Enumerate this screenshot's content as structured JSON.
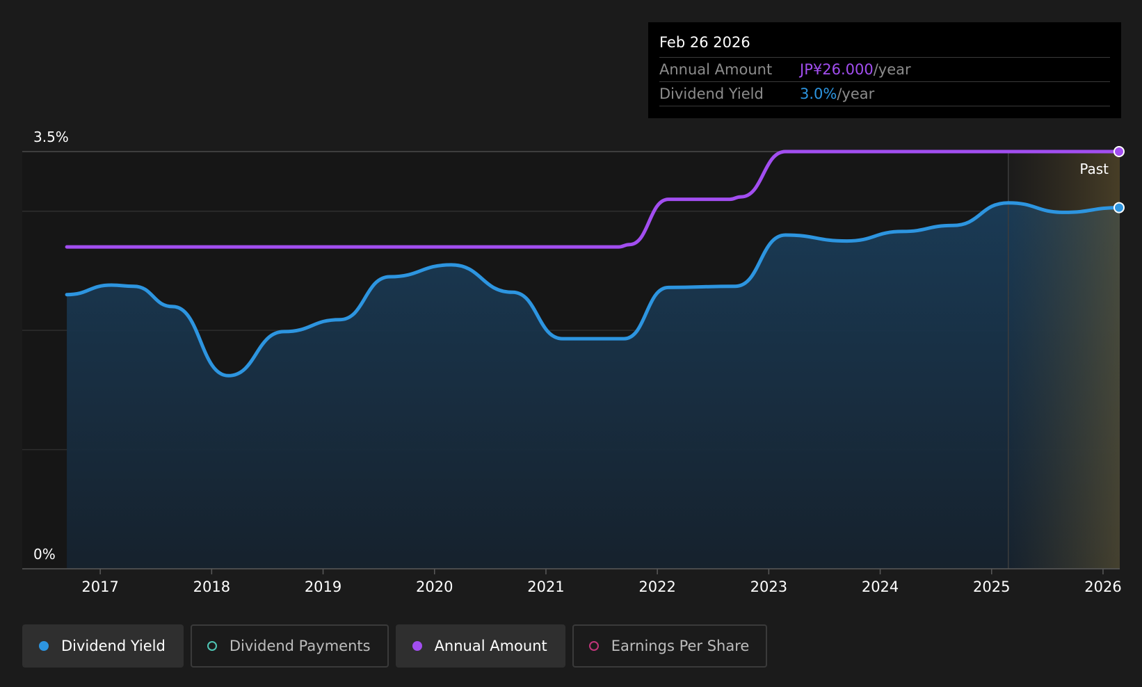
{
  "tooltip": {
    "date": "Feb 26 2026",
    "rows": [
      {
        "label": "Annual Amount",
        "value": "JP¥26.000",
        "suffix": "/year",
        "color": "#a24ef0"
      },
      {
        "label": "Dividend Yield",
        "value": "3.0%",
        "suffix": "/year",
        "color": "#2d95e0"
      }
    ]
  },
  "legend": [
    {
      "label": "Dividend Yield",
      "color": "#2d95e0",
      "filled": true,
      "active": true
    },
    {
      "label": "Dividend Payments",
      "color": "#4fc5b4",
      "filled": false,
      "active": false
    },
    {
      "label": "Annual Amount",
      "color": "#a24ef0",
      "filled": true,
      "active": true
    },
    {
      "label": "Earnings Per Share",
      "color": "#c0357a",
      "filled": false,
      "active": false
    }
  ],
  "chart_data": {
    "type": "line",
    "y_ticks": [
      "0%",
      "3.5%"
    ],
    "ylim": [
      0,
      3.5
    ],
    "xlim": [
      2016.3,
      2026.15
    ],
    "x_ticks": [
      "2017",
      "2018",
      "2019",
      "2020",
      "2021",
      "2022",
      "2023",
      "2024",
      "2025",
      "2026"
    ],
    "gridlines": [
      1,
      2,
      3,
      3.5
    ],
    "past_region": {
      "label": "Past",
      "start": 2025.15
    },
    "series": [
      {
        "name": "Dividend Yield",
        "color": "#2d95e0",
        "area": true,
        "x": [
          2016.7,
          2017.1,
          2017.3,
          2017.65,
          2018.15,
          2018.65,
          2019.15,
          2019.6,
          2020.15,
          2020.7,
          2021.15,
          2021.7,
          2022.1,
          2022.7,
          2023.15,
          2023.7,
          2024.2,
          2024.65,
          2025.15,
          2025.65,
          2026.15
        ],
        "y": [
          2.3,
          2.38,
          2.37,
          2.2,
          1.62,
          1.99,
          2.09,
          2.45,
          2.55,
          2.32,
          1.93,
          1.93,
          2.36,
          2.37,
          2.8,
          2.75,
          2.83,
          2.88,
          3.07,
          2.99,
          3.03
        ]
      },
      {
        "name": "Annual Amount",
        "color": "#a24ef0",
        "area": false,
        "x": [
          2016.7,
          2021.65,
          2021.75,
          2022.1,
          2022.65,
          2022.75,
          2023.15,
          2026.15
        ],
        "y": [
          2.7,
          2.7,
          2.72,
          3.1,
          3.1,
          3.12,
          3.5,
          3.5
        ]
      }
    ]
  }
}
